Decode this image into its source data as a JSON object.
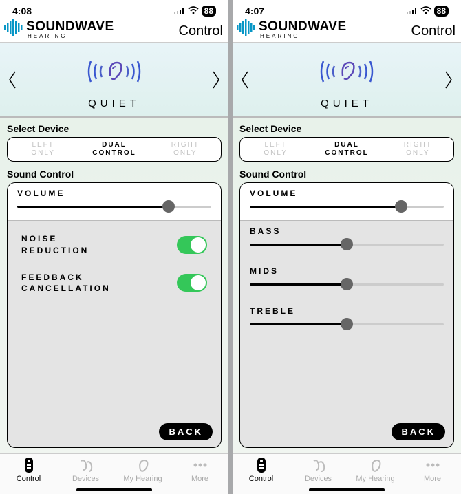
{
  "left": {
    "status": {
      "time": "4:08",
      "battery": "88"
    },
    "brand": {
      "main": "SOUNDWAVE",
      "sub": "HEARING"
    },
    "page_title": "Control",
    "mode": "QUIET",
    "select_device_label": "Select Device",
    "segments": {
      "left": "LEFT\nONLY",
      "dual": "DUAL\nCONTROL",
      "right": "RIGHT\nONLY"
    },
    "sound_control_label": "Sound Control",
    "volume_label": "VOLUME",
    "volume_pct": 78,
    "toggles": {
      "noise": {
        "label": "NOISE\nREDUCTION",
        "on": true
      },
      "feedback": {
        "label": "FEEDBACK\nCANCELLATION",
        "on": true
      }
    },
    "back_label": "BACK",
    "tabs": {
      "control": "Control",
      "devices": "Devices",
      "hearing": "My Hearing",
      "more": "More"
    }
  },
  "right": {
    "status": {
      "time": "4:07",
      "battery": "88"
    },
    "brand": {
      "main": "SOUNDWAVE",
      "sub": "HEARING"
    },
    "page_title": "Control",
    "mode": "QUIET",
    "select_device_label": "Select Device",
    "segments": {
      "left": "LEFT\nONLY",
      "dual": "DUAL\nCONTROL",
      "right": "RIGHT\nONLY"
    },
    "sound_control_label": "Sound Control",
    "volume_label": "VOLUME",
    "volume_pct": 78,
    "eq": {
      "bass": {
        "label": "BASS",
        "pct": 50
      },
      "mids": {
        "label": "MIDS",
        "pct": 50
      },
      "treble": {
        "label": "TREBLE",
        "pct": 50
      }
    },
    "back_label": "BACK",
    "tabs": {
      "control": "Control",
      "devices": "Devices",
      "hearing": "My Hearing",
      "more": "More"
    }
  }
}
